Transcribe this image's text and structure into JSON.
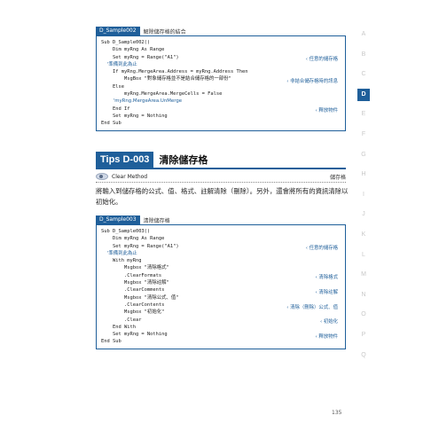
{
  "sample1": {
    "tag": "D_Sample002",
    "title": "解除儲存格的結合",
    "lines": [
      "Sub D_Sample002()",
      "    Dim myRng As Range",
      "    Set myRng = Range(\"A1\")",
      "    '準備到此為止",
      "    If myRng.MergeArea.Address = myRng.Address Then",
      "        MsgBox \"對象儲存格並不是結合儲存格的一部份\"",
      "    Else",
      "        myRng.MergeArea.MergeCells = False",
      "        'myRng.MergeArea.UnMerge",
      "    End If",
      "    Set myRng = Nothing",
      "End Sub"
    ],
    "notes": [
      "任意的儲存格",
      "非結合儲存格時的訊息",
      "釋放物件"
    ]
  },
  "tips": {
    "badge": "Tips D-003",
    "title": "清除儲存格",
    "method": "Clear Method",
    "kind": "儲存格"
  },
  "body_text": "將輸入到儲存格的公式、值、格式、註解清除（刪除）。另外，還會將所有的資訊清除以初始化。",
  "sample2": {
    "tag": "D_Sample003",
    "title": "清除儲存格",
    "lines": [
      "Sub D_Sample003()",
      "    Dim myRng As Range",
      "    Set myRng = Range(\"A1\")",
      "    '準備到此為止",
      "    With myRng",
      "        Msgbox \"清除格式\"",
      "        .ClearFormats",
      "        Msgbox \"清除註解\"",
      "        .ClearComments",
      "        Msgbox \"清除公式、值\"",
      "        .ClearContents",
      "        Msgbox \"初始化\"",
      "        .Clear",
      "    End With",
      "    Set myRng = Nothing",
      "End Sub"
    ],
    "notes": [
      "任意的儲存格",
      "清除格式",
      "清除註解",
      "清除（刪除）公式、值",
      "初始化",
      "釋放物件"
    ]
  },
  "side_index": [
    "A",
    "B",
    "C",
    "D",
    "E",
    "F",
    "G",
    "H",
    "I",
    "J",
    "K",
    "L",
    "M",
    "N",
    "O",
    "P",
    "Q"
  ],
  "active_index": "D",
  "page_number": "135",
  "colors": {
    "accent": "#1f5f9a"
  }
}
